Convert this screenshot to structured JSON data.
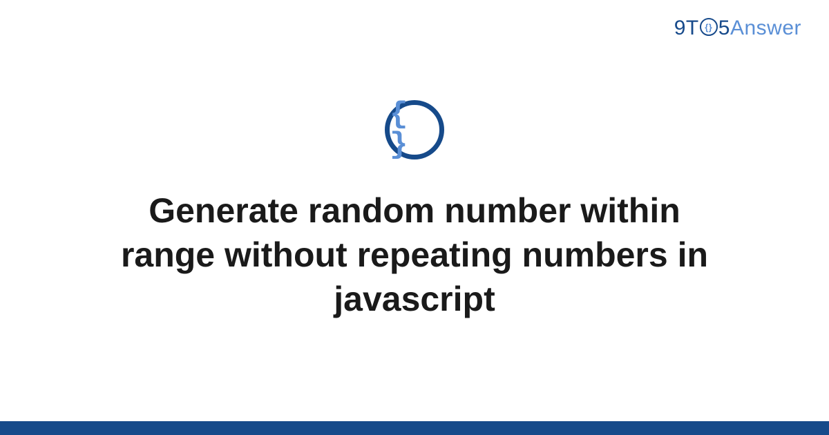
{
  "brand": {
    "part1": "9T",
    "circle_inner": "{}",
    "part2": "5",
    "part3": "Answer"
  },
  "category_icon": {
    "glyph": "{ }",
    "name": "code-braces-icon"
  },
  "title": "Generate random number within range without repeating numbers in javascript",
  "colors": {
    "brand_dark": "#164a8a",
    "brand_light": "#5a8fd6"
  }
}
